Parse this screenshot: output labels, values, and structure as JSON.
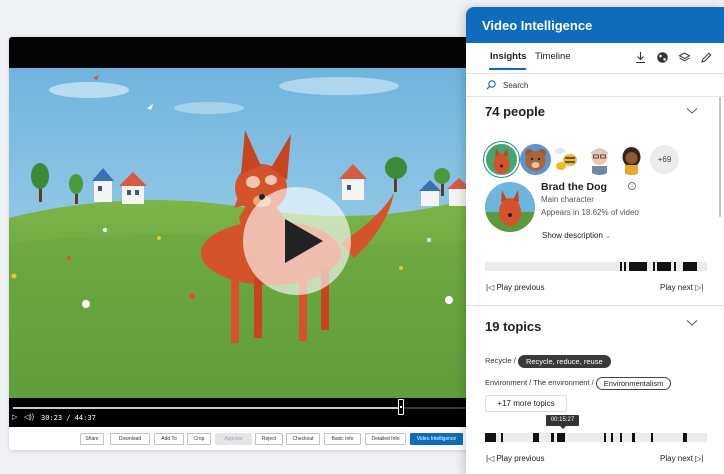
{
  "player": {
    "time": "30:23 / 44:37",
    "progress_fraction": 0.855
  },
  "actions": [
    {
      "label": "Share",
      "state": "normal"
    },
    {
      "label": "Download",
      "state": "normal"
    },
    {
      "label": "Add To",
      "state": "normal"
    },
    {
      "label": "Crop",
      "state": "normal"
    },
    {
      "label": "Approve",
      "state": "disabled"
    },
    {
      "label": "Reject",
      "state": "normal"
    },
    {
      "label": "Checkout",
      "state": "normal"
    },
    {
      "label": "Basic Info",
      "state": "normal"
    },
    {
      "label": "Detailed Info",
      "state": "normal"
    },
    {
      "label": "Video Intelligence",
      "state": "primary"
    }
  ],
  "panel": {
    "title": "Video Intelligence",
    "tabs": [
      "Insights",
      "Timeline"
    ],
    "search_placeholder": "Search",
    "people": {
      "title": "74 people",
      "more_badge": "+69",
      "selected": {
        "name": "Brad the Dog",
        "role": "Main character",
        "appearance": "Appears in 18.62% of video",
        "show_description": "Show description"
      },
      "play_previous": "Play previous",
      "play_next": "Play next"
    },
    "topics": {
      "title": "19 topics",
      "row1_prefix": "Recycle /",
      "row1_chip": "Recycle, reduce, reuse",
      "row2_prefix": "Environment / The environment /",
      "row2_chip": "Environmentalism",
      "more": "+17 more topics",
      "tooltip_time": "00:15:27",
      "play_previous": "Play previous",
      "play_next": "Play next"
    }
  },
  "colors": {
    "accent": "#0f6cbd",
    "sky": "#6fb4dd",
    "grass": "#5a9a3a",
    "dog": "#d4532c"
  }
}
